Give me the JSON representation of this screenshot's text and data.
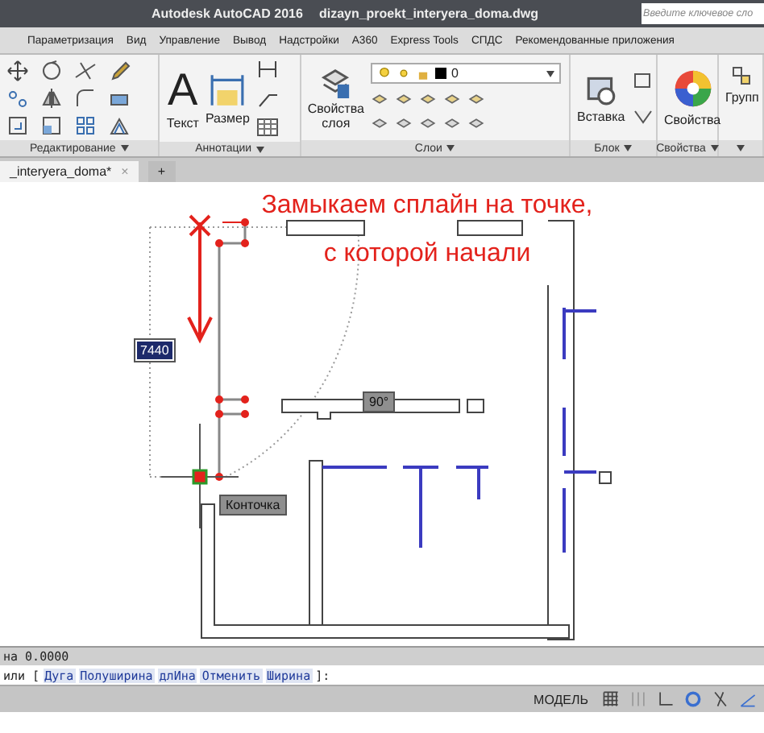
{
  "title_bar": {
    "app": "Autodesk AutoCAD 2016",
    "file": "dizayn_proekt_interyera_doma.dwg",
    "search": {
      "placeholder": "Введите ключевое сло"
    }
  },
  "menu_tabs": [
    {
      "label": "Параметризация",
      "selected": false
    },
    {
      "label": "Вид",
      "selected": false
    },
    {
      "label": "Управление",
      "selected": false
    },
    {
      "label": "Вывод",
      "selected": false
    },
    {
      "label": "Надстройки",
      "selected": false
    },
    {
      "label": "A360",
      "selected": false
    },
    {
      "label": "Express Tools",
      "selected": false
    },
    {
      "label": "СПДС",
      "selected": false
    },
    {
      "label": "Рекомендованные приложения",
      "selected": false
    }
  ],
  "ribbon": {
    "panels": [
      {
        "label": "Редактирование",
        "kind": "edit"
      },
      {
        "label": "Аннотации",
        "kind": "annotate",
        "icon_text": "A",
        "tools": [
          "Текст",
          "Размер"
        ]
      },
      {
        "label": "Слои",
        "kind": "layers",
        "tools": [
          "Свойства слоя"
        ],
        "layer": "0"
      },
      {
        "label": "Блок",
        "kind": "block",
        "tools": [
          "Вставка"
        ]
      },
      {
        "label": "Свойства",
        "kind": "props",
        "tools": [
          "Свойства"
        ]
      },
      {
        "kind": "groups",
        "tools": [
          "Групп"
        ]
      }
    ]
  },
  "doc_tabs": [
    {
      "label": "_interyera_doma*",
      "close": "×",
      "selected": true
    },
    {
      "label": "+",
      "selected": false
    }
  ],
  "drawing": {
    "annotation": "Замыкаем сплайн на точке,\nс которой начали",
    "length_input": "7440",
    "angle_tooltip": "90°",
    "snap_tooltip": "Конточка"
  },
  "command": {
    "history": "на 0.0000",
    "prompt": "или [",
    "options": [
      "Дуга",
      "Полуширина",
      "длИна",
      "Отменить",
      "Ширина"
    ],
    "suffix": "]:"
  },
  "status_bar": {
    "mode": "МОДЕЛЬ"
  }
}
